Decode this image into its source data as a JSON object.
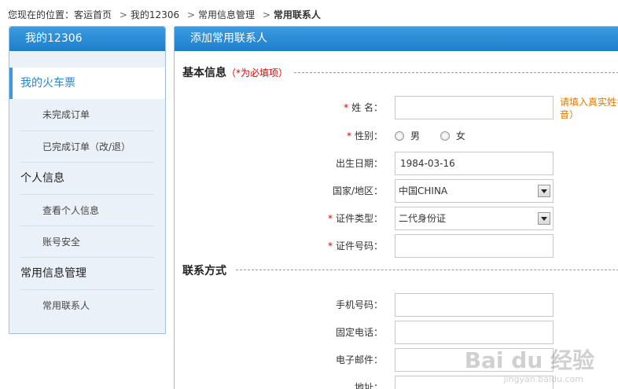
{
  "breadcrumb": {
    "prefix": "您现在的位置：",
    "items": [
      "客运首页",
      "我的12306",
      "常用信息管理"
    ],
    "current": "常用联系人",
    "separator": ">"
  },
  "sidebar": {
    "title": "我的12306",
    "active": "我的火车票",
    "items": [
      {
        "type": "sub",
        "label": "未完成订单"
      },
      {
        "type": "sub",
        "label": "已完成订单（改/退）"
      },
      {
        "type": "group",
        "label": "个人信息"
      },
      {
        "type": "sub",
        "label": "查看个人信息"
      },
      {
        "type": "sub",
        "label": "账号安全"
      },
      {
        "type": "group",
        "label": "常用信息管理"
      },
      {
        "type": "sub",
        "label": "常用联系人"
      }
    ]
  },
  "main": {
    "title": "添加常用联系人",
    "basic_section": {
      "title": "基本信息",
      "required_note": "（*为必填项）"
    },
    "fields": {
      "name": {
        "label": "姓 名：",
        "required": "*",
        "value": "",
        "hint": "请填入真实姓名（拼音）"
      },
      "gender": {
        "label": "性别：",
        "required": "*",
        "option_male": "男",
        "option_female": "女"
      },
      "birth": {
        "label": "出生日期：",
        "value": "1984-03-16"
      },
      "country": {
        "label": "国家/地区：",
        "value": "中国CHINA"
      },
      "id_type": {
        "label": "证件类型：",
        "required": "*",
        "value": "二代身份证"
      },
      "id_number": {
        "label": "证件号码：",
        "required": "*",
        "value": ""
      }
    },
    "contact_section": {
      "title": "联系方式"
    },
    "contact_fields": {
      "mobile": {
        "label": "手机号码：",
        "value": ""
      },
      "phone": {
        "label": "固定电话：",
        "value": ""
      },
      "email": {
        "label": "电子邮件：",
        "value": ""
      },
      "address": {
        "label": "地址：",
        "value": ""
      }
    }
  },
  "watermark": {
    "brand": "Bai du 经验",
    "url": "jingyan.baidu.com"
  }
}
